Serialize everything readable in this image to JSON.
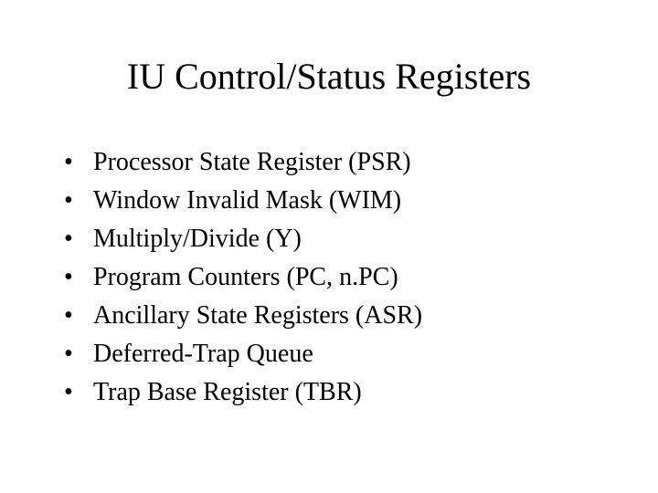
{
  "title": "IU Control/Status Registers",
  "bullets": {
    "b0": "Processor State Register (PSR)",
    "b1": "Window Invalid Mask (WIM)",
    "b2": "Multiply/Divide (Y)",
    "b3": "Program Counters (PC, n.PC)",
    "b4": "Ancillary State Registers (ASR)",
    "b5": "Deferred-Trap Queue",
    "b6": "Trap Base Register (TBR)"
  }
}
